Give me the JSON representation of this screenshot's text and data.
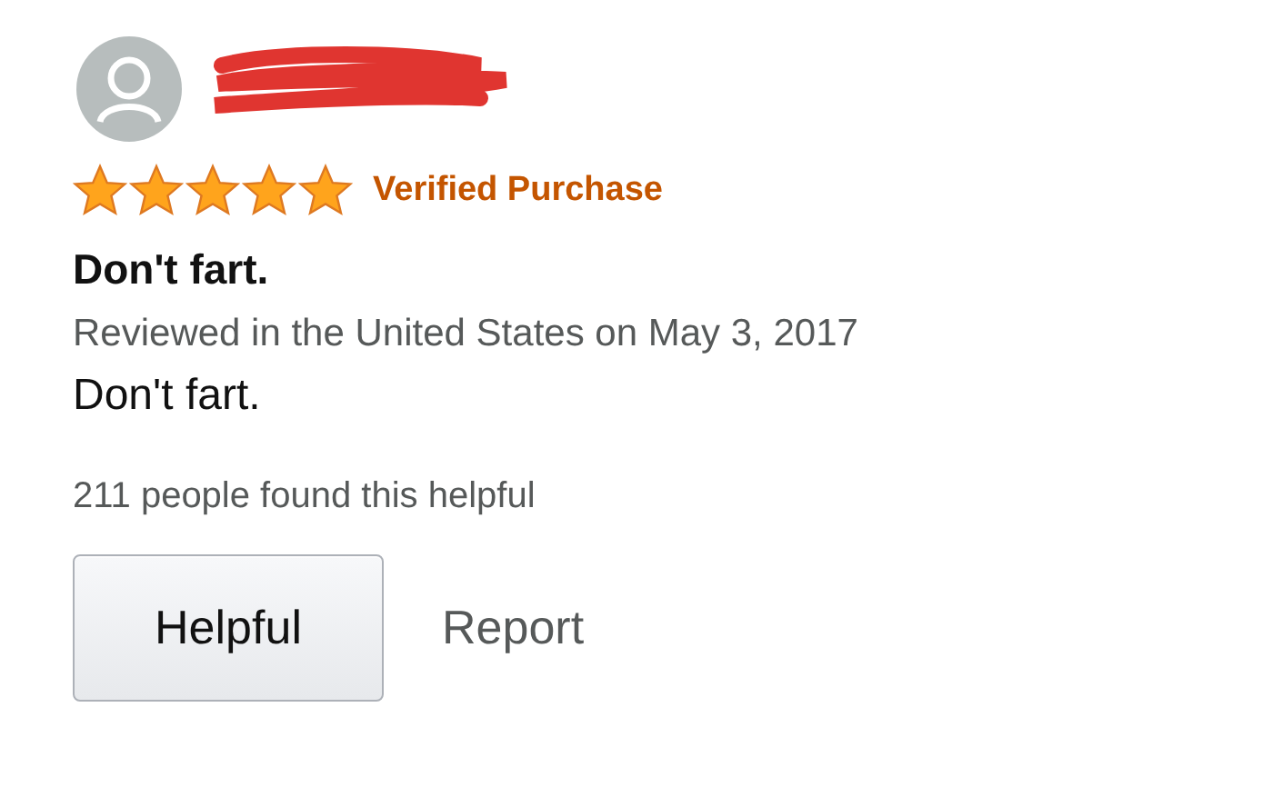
{
  "review": {
    "stars": 5,
    "badge": "Verified Purchase",
    "title": "Don't fart.",
    "meta": "Reviewed in the United States on May 3, 2017",
    "body": "Don't fart.",
    "helpful_count": "211 people found this helpful"
  },
  "actions": [
    {
      "kind": "button",
      "label": "Helpful"
    },
    {
      "kind": "link",
      "label": "Report"
    }
  ]
}
